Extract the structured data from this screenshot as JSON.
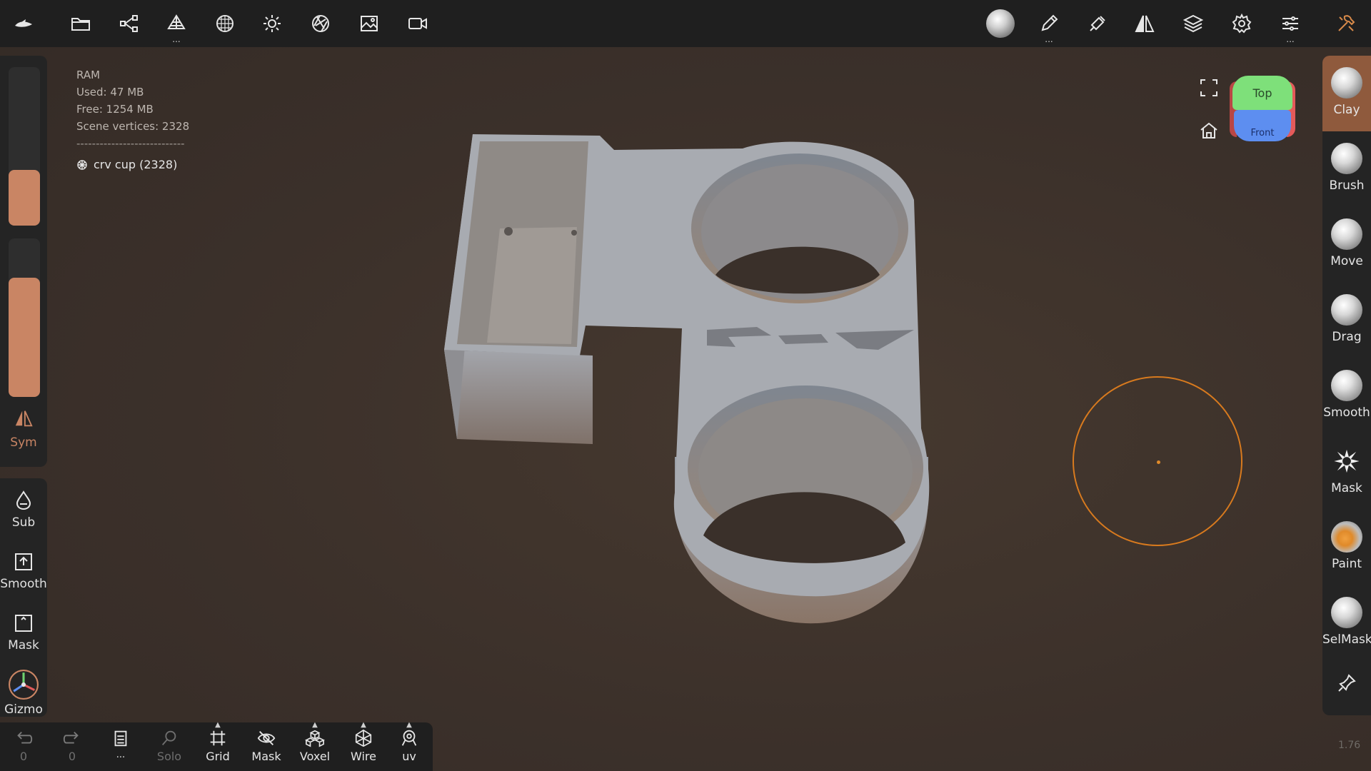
{
  "app": {
    "version": "1.76"
  },
  "top_toolbar": {
    "items": [
      {
        "name": "logo-icon"
      },
      {
        "name": "files-icon"
      },
      {
        "name": "scene-tree-icon"
      },
      {
        "name": "topology-icon",
        "dots": "..."
      },
      {
        "name": "material-icon"
      },
      {
        "name": "light-icon"
      },
      {
        "name": "camera-aperture-icon"
      },
      {
        "name": "background-image-icon"
      },
      {
        "name": "video-camera-icon"
      }
    ],
    "right_items": [
      {
        "name": "material-sphere-icon"
      },
      {
        "name": "pen-icon",
        "dots": "..."
      },
      {
        "name": "brush-settings-icon"
      },
      {
        "name": "symmetry-icon"
      },
      {
        "name": "layers-icon"
      },
      {
        "name": "settings-icon"
      },
      {
        "name": "sliders-icon",
        "dots": "..."
      },
      {
        "name": "tools-icon"
      }
    ]
  },
  "info": {
    "ram_label": "RAM",
    "used": "Used: 47 MB",
    "free": "Free: 1254 MB",
    "vertices": "Scene vertices: 2328",
    "separator": "----------------------------",
    "mesh_name": "crv cup (2328)"
  },
  "left_panel": {
    "radius_fraction": 0.35,
    "intensity_fraction": 0.75,
    "sym_label": "Sym"
  },
  "left_tools": [
    {
      "label": "Sub",
      "icon": "drop-icon"
    },
    {
      "label": "Smooth",
      "icon": "smooth-box-icon"
    },
    {
      "label": "Mask",
      "icon": "mask-box-icon"
    },
    {
      "label": "Gizmo",
      "icon": "gizmo-icon"
    }
  ],
  "right_tools": [
    {
      "label": "Clay",
      "active": true
    },
    {
      "label": "Brush"
    },
    {
      "label": "Move"
    },
    {
      "label": "Drag"
    },
    {
      "label": "Smooth"
    },
    {
      "label": "Mask"
    },
    {
      "label": "Paint"
    },
    {
      "label": "SelMask"
    }
  ],
  "bottom_bar": [
    {
      "label": "0",
      "icon": "undo-icon",
      "dim": true
    },
    {
      "label": "0",
      "icon": "redo-icon",
      "dim": true
    },
    {
      "label": "...",
      "icon": "notes-icon"
    },
    {
      "label": "Solo",
      "icon": "search-icon",
      "dim": true
    },
    {
      "label": "Grid",
      "icon": "grid-icon"
    },
    {
      "label": "Mask",
      "icon": "eye-off-icon"
    },
    {
      "label": "Voxel",
      "icon": "voxel-icon"
    },
    {
      "label": "Wire",
      "icon": "wire-icon"
    },
    {
      "label": "uv",
      "icon": "uv-icon"
    }
  ],
  "view_cube": {
    "top": "Top",
    "front": "Front"
  },
  "colors": {
    "accent": "#c98564",
    "active_tool": "#8f5a3d",
    "brush_cursor": "#d87a1e"
  }
}
